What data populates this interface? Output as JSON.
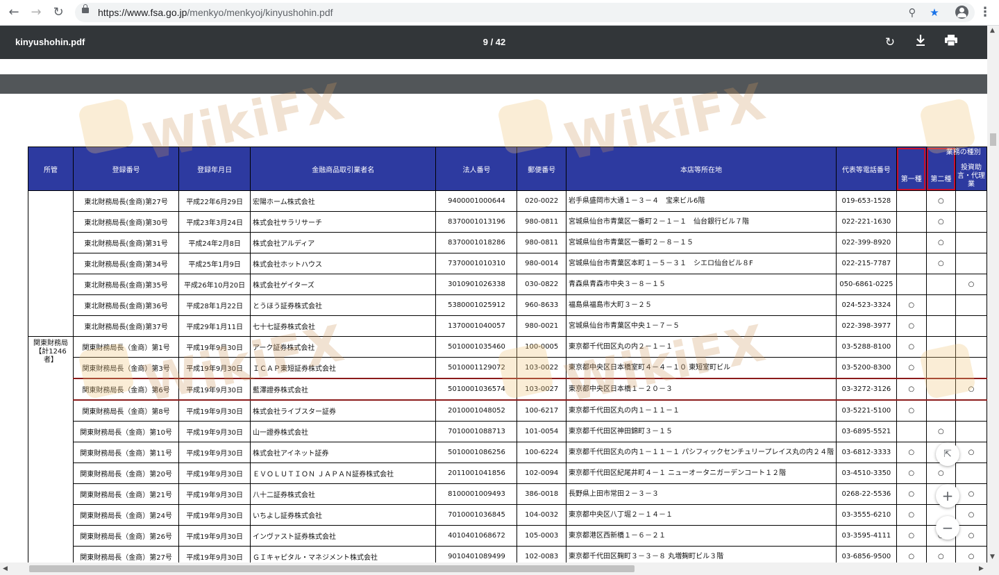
{
  "browser": {
    "url_host": "https://www.fsa.go.jp",
    "url_path": "/menkyo/menkyoj/kinyushohin.pdf"
  },
  "viewer": {
    "file_name": "kinyushohin.pdf",
    "page_indicator": "9 / 42"
  },
  "watermark": "WikiFX",
  "table": {
    "headers": {
      "jurisdiction": "所管",
      "reg_no": "登録番号",
      "reg_date": "登録年月日",
      "name": "金融商品取引業者名",
      "corp_no": "法人番号",
      "postal": "郵便番号",
      "address": "本店等所在地",
      "phone": "代表等電話番号",
      "biz_type_group": "業務の種別",
      "type1": "第一種",
      "type2": "第二種",
      "advisory": "投資助言・代理業"
    },
    "kanto_label": "関東財務局\n【計1246者】",
    "rows": [
      {
        "reg_no": "東北財務局長(金商)第27号",
        "date": "平成22年6月29日",
        "name": "宏陽ホーム株式会社",
        "corp": "9400001000644",
        "postal": "020-0022",
        "addr": "岩手県盛岡市大通１－３－４　宝来ビル6階",
        "phone": "019-653-1528",
        "t1": "",
        "t2": "○",
        "adv": ""
      },
      {
        "reg_no": "東北財務局長(金商)第30号",
        "date": "平成23年3月24日",
        "name": "株式会社サラリサーチ",
        "corp": "8370001013196",
        "postal": "980-0811",
        "addr": "宮城県仙台市青葉区一番町２－１－１　仙台銀行ビル７階",
        "phone": "022-221-1630",
        "t1": "",
        "t2": "○",
        "adv": ""
      },
      {
        "reg_no": "東北財務局長(金商)第31号",
        "date": "平成24年2月8日",
        "name": "株式会社アルディア",
        "corp": "8370001018286",
        "postal": "980-0811",
        "addr": "宮城県仙台市青葉区一番町２－８－１５",
        "phone": "022-399-8920",
        "t1": "",
        "t2": "○",
        "adv": ""
      },
      {
        "reg_no": "東北財務局長(金商)第34号",
        "date": "平成25年1月9日",
        "name": "株式会社ホットハウス",
        "corp": "7370001010310",
        "postal": "980-0014",
        "addr": "宮城県仙台市青葉区本町１－５－３１　シエロ仙台ビル８F",
        "phone": "022-215-7787",
        "t1": "",
        "t2": "○",
        "adv": ""
      },
      {
        "reg_no": "東北財務局長(金商)第35号",
        "date": "平成26年10月20日",
        "name": "株式会社ゲイターズ",
        "corp": "3010901026338",
        "postal": "030-0822",
        "addr": "青森県青森市中央３－８－１５",
        "phone": "050-6861-0225",
        "t1": "",
        "t2": "",
        "adv": "○"
      },
      {
        "reg_no": "東北財務局長(金商)第36号",
        "date": "平成28年1月22日",
        "name": "とうほう証券株式会社",
        "corp": "5380001025912",
        "postal": "960-8633",
        "addr": "福島県福島市大町３－２５",
        "phone": "024-523-3324",
        "t1": "○",
        "t2": "",
        "adv": ""
      },
      {
        "reg_no": "東北財務局長(金商)第37号",
        "date": "平成29年1月11日",
        "name": "七十七証券株式会社",
        "corp": "1370001040057",
        "postal": "980-0021",
        "addr": "宮城県仙台市青葉区中央１－７－５",
        "phone": "022-398-3977",
        "t1": "○",
        "t2": "",
        "adv": ""
      },
      {
        "reg_no": "関東財務局長（金商）第1号",
        "date": "平成19年9月30日",
        "name": "アーク証券株式会社",
        "corp": "5010001035460",
        "postal": "100-0005",
        "addr": "東京都千代田区丸の内２－１－１",
        "phone": "03-5288-8100",
        "t1": "○",
        "t2": "",
        "adv": ""
      },
      {
        "reg_no": "関東財務局長（金商）第3号",
        "date": "平成19年9月30日",
        "name": "ＩＣＡＰ東短証券株式会社",
        "corp": "5010001129072",
        "postal": "103-0022",
        "addr": "東京都中央区日本橋室町４－４－１０ 東短室町ビル",
        "phone": "03-5200-8300",
        "t1": "○",
        "t2": "",
        "adv": ""
      },
      {
        "reg_no": "関東財務局長（金商）第6号",
        "date": "平成19年9月30日",
        "name": "藍澤證券株式会社",
        "corp": "5010001036574",
        "postal": "103-0027",
        "addr": "東京都中央区日本橋１－２０－３",
        "phone": "03-3272-3126",
        "t1": "○",
        "t2": "",
        "adv": "○"
      },
      {
        "reg_no": "関東財務局長（金商）第8号",
        "date": "平成19年9月30日",
        "name": "株式会社ライブスター証券",
        "corp": "2010001048052",
        "postal": "100-6217",
        "addr": "東京都千代田区丸の内１－１１－１",
        "phone": "03-5221-5100",
        "t1": "○",
        "t2": "",
        "adv": ""
      },
      {
        "reg_no": "関東財務局長（金商）第10号",
        "date": "平成19年9月30日",
        "name": "山一證券株式会社",
        "corp": "7010001088713",
        "postal": "101-0054",
        "addr": "東京都千代田区神田錦町３－１５",
        "phone": "03-6895-5521",
        "t1": "",
        "t2": "○",
        "adv": ""
      },
      {
        "reg_no": "関東財務局長（金商）第11号",
        "date": "平成19年9月30日",
        "name": "株式会社アイネット証券",
        "corp": "5010001086256",
        "postal": "100-6224",
        "addr": "東京都千代田区丸の内１－１１－１ パシフィックセンチュリープレイス丸の内２４階",
        "phone": "03-6812-3333",
        "t1": "○",
        "t2": "○",
        "adv": "○"
      },
      {
        "reg_no": "関東財務局長（金商）第20号",
        "date": "平成19年9月30日",
        "name": "ＥＶＯＬＵＴＩＯＮ ＪＡＰＡＮ証券株式会社",
        "corp": "2011001041856",
        "postal": "102-0094",
        "addr": "東京都千代田区紀尾井町４－１ ニューオータニガーデンコート１２階",
        "phone": "03-4510-3350",
        "t1": "○",
        "t2": "○",
        "adv": ""
      },
      {
        "reg_no": "関東財務局長（金商）第21号",
        "date": "平成19年9月30日",
        "name": "八十二証券株式会社",
        "corp": "8100001009493",
        "postal": "386-0018",
        "addr": "長野県上田市常田２－３－３",
        "phone": "0268-22-5536",
        "t1": "○",
        "t2": "",
        "adv": "○"
      },
      {
        "reg_no": "関東財務局長（金商）第24号",
        "date": "平成19年9月30日",
        "name": "いちよし証券株式会社",
        "corp": "7010001036845",
        "postal": "104-0032",
        "addr": "東京都中央区八丁堀２－１４－１",
        "phone": "03-3555-6210",
        "t1": "○",
        "t2": "",
        "adv": "○"
      },
      {
        "reg_no": "関東財務局長（金商）第26号",
        "date": "平成19年9月30日",
        "name": "インヴァスト証券株式会社",
        "corp": "4010401068672",
        "postal": "105-0003",
        "addr": "東京都港区西新橋１－６－２１",
        "phone": "03-3595-4111",
        "t1": "○",
        "t2": "○",
        "adv": "○"
      },
      {
        "reg_no": "関東財務局長（金商）第27号",
        "date": "平成19年9月30日",
        "name": "ＧＩキャピタル・マネジメント株式会社",
        "corp": "9010401089499",
        "postal": "102-0083",
        "addr": "東京都千代田区麹町３－３－８ 丸増麹町ビル３階",
        "phone": "03-6856-9500",
        "t1": "○",
        "t2": "○",
        "adv": "○"
      }
    ]
  }
}
